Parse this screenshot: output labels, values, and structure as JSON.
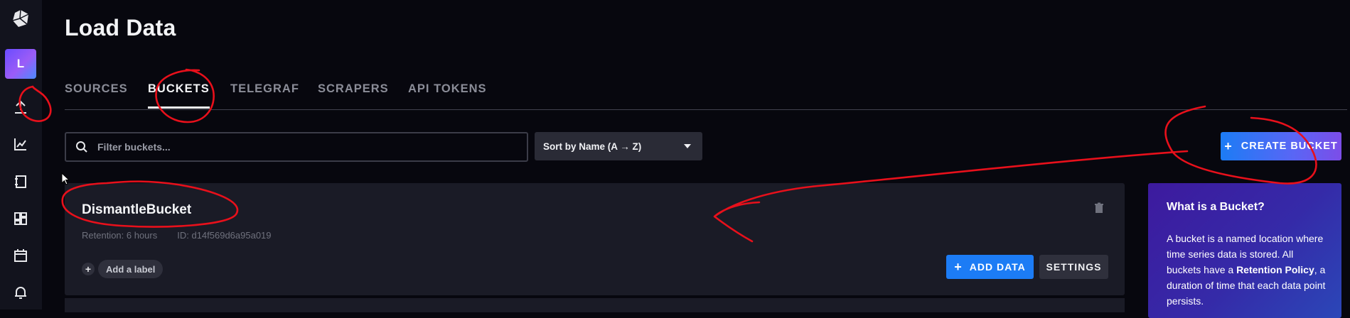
{
  "sidebar": {
    "org_initial": "L",
    "icons": [
      "influx-logo-icon",
      "upload-icon",
      "graph-icon",
      "notebook-icon",
      "dashboard-icon",
      "calendar-icon",
      "bell-icon"
    ]
  },
  "page": {
    "title": "Load Data"
  },
  "tabs": [
    {
      "label": "SOURCES",
      "active": false
    },
    {
      "label": "BUCKETS",
      "active": true
    },
    {
      "label": "TELEGRAF",
      "active": false
    },
    {
      "label": "SCRAPERS",
      "active": false
    },
    {
      "label": "API TOKENS",
      "active": false
    }
  ],
  "toolbar": {
    "search_placeholder": "Filter buckets...",
    "search_value": "",
    "sort_label": "Sort by Name (A → Z)",
    "create_label": "CREATE BUCKET",
    "create_plus": "+"
  },
  "bucket": {
    "name": "DismantleBucket",
    "retention": "Retention: 6 hours",
    "id": "ID: d14f569d6a95a019",
    "add_label_plus": "+",
    "add_label": "Add a label",
    "add_data_plus": "+",
    "add_data_label": "ADD DATA",
    "settings_label": "SETTINGS"
  },
  "info": {
    "title": "What is a Bucket?",
    "body_part1": "A bucket is a named location where time series data is stored. All buckets have a ",
    "body_bold": "Retention Policy",
    "body_part2": ", a duration of time that each data point persists."
  },
  "colors": {
    "background": "#07070e",
    "sidebar": "#12131d",
    "card": "#1a1b26",
    "accent_blue": "#1c7cf5",
    "annotation_red": "#e8101b"
  }
}
